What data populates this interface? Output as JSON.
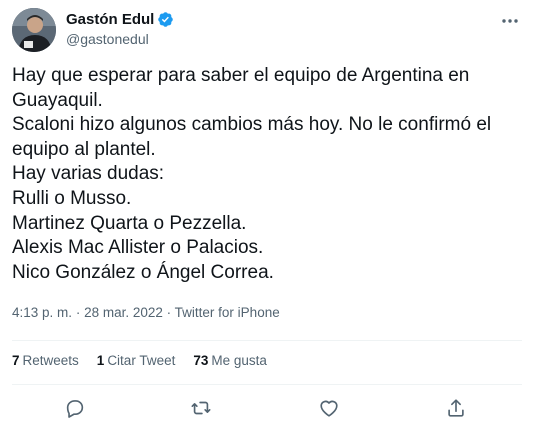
{
  "user": {
    "display_name": "Gastón Edul",
    "handle": "@gastonedul"
  },
  "tweet": {
    "text": "Hay que esperar para saber el equipo de Argentina en Guayaquil.\nScaloni hizo algunos cambios más hoy. No le confirmó el equipo al plantel.\nHay varias dudas:\nRulli o Musso.\nMartinez Quarta o Pezzella.\nAlexis Mac Allister o Palacios.\nNico González o Ángel Correa.",
    "time": "4:13 p. m.",
    "separator": "·",
    "date": "28 mar. 2022",
    "source": "Twitter for iPhone"
  },
  "stats": {
    "retweets_count": "7",
    "retweets_label": "Retweets",
    "quotes_count": "1",
    "quotes_label": "Citar Tweet",
    "likes_count": "73",
    "likes_label": "Me gusta"
  },
  "icons": {
    "verified": "verified-badge-icon",
    "more": "more-options-icon",
    "reply": "reply-icon",
    "retweet": "retweet-icon",
    "like": "heart-icon",
    "share": "share-icon"
  },
  "colors": {
    "verified": "#1d9bf0",
    "text": "#0f1419",
    "secondary": "#536471",
    "divider": "#eff3f4"
  }
}
